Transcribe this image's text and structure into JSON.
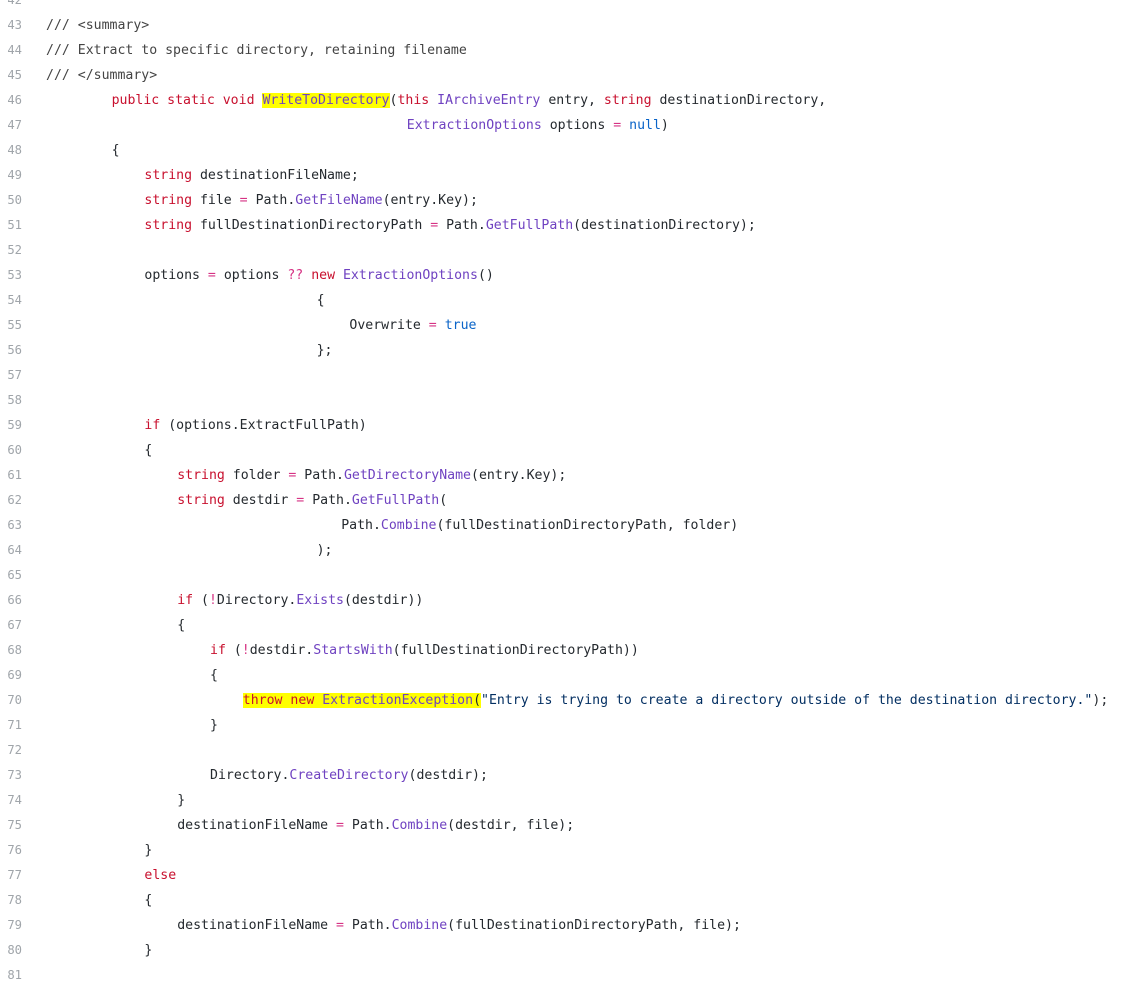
{
  "code_view": {
    "lines": [
      {
        "number": "42",
        "indent": 0,
        "tokens": []
      },
      {
        "number": "43",
        "indent": 0,
        "tokens": [
          {
            "text": "/// <summary>",
            "kind": "com"
          }
        ]
      },
      {
        "number": "44",
        "indent": 0,
        "tokens": [
          {
            "text": "/// Extract to specific directory, retaining filename",
            "kind": "com"
          }
        ]
      },
      {
        "number": "45",
        "indent": 0,
        "tokens": [
          {
            "text": "/// </summary>",
            "kind": "com"
          }
        ]
      },
      {
        "number": "46",
        "indent": 8,
        "tokens": [
          {
            "text": "public static void ",
            "kind": "kw"
          },
          {
            "text": "WriteToDirectory",
            "kind": "type",
            "highlight": true
          },
          {
            "text": "(",
            "kind": "plain"
          },
          {
            "text": "this ",
            "kind": "kw"
          },
          {
            "text": "IArchiveEntry",
            "kind": "type"
          },
          {
            "text": " entry, ",
            "kind": "plain"
          },
          {
            "text": "string",
            "kind": "kw"
          },
          {
            "text": " destinationDirectory,",
            "kind": "plain"
          }
        ]
      },
      {
        "number": "47",
        "indent": 44,
        "tokens": [
          {
            "text": "ExtractionOptions",
            "kind": "type"
          },
          {
            "text": " options ",
            "kind": "plain"
          },
          {
            "text": "=",
            "kind": "op"
          },
          {
            "text": " ",
            "kind": "plain"
          },
          {
            "text": "null",
            "kind": "lit"
          },
          {
            "text": ")",
            "kind": "plain"
          }
        ]
      },
      {
        "number": "48",
        "indent": 8,
        "tokens": [
          {
            "text": "{",
            "kind": "plain"
          }
        ]
      },
      {
        "number": "49",
        "indent": 12,
        "tokens": [
          {
            "text": "string",
            "kind": "kw"
          },
          {
            "text": " destinationFileName;",
            "kind": "plain"
          }
        ]
      },
      {
        "number": "50",
        "indent": 12,
        "tokens": [
          {
            "text": "string",
            "kind": "kw"
          },
          {
            "text": " file ",
            "kind": "plain"
          },
          {
            "text": "=",
            "kind": "op"
          },
          {
            "text": " Path.",
            "kind": "plain"
          },
          {
            "text": "GetFileName",
            "kind": "type"
          },
          {
            "text": "(entry.Key);",
            "kind": "plain"
          }
        ]
      },
      {
        "number": "51",
        "indent": 12,
        "tokens": [
          {
            "text": "string",
            "kind": "kw"
          },
          {
            "text": " fullDestinationDirectoryPath ",
            "kind": "plain"
          },
          {
            "text": "=",
            "kind": "op"
          },
          {
            "text": " Path.",
            "kind": "plain"
          },
          {
            "text": "GetFullPath",
            "kind": "type"
          },
          {
            "text": "(destinationDirectory);",
            "kind": "plain"
          }
        ]
      },
      {
        "number": "52",
        "indent": 0,
        "tokens": []
      },
      {
        "number": "53",
        "indent": 12,
        "tokens": [
          {
            "text": "options ",
            "kind": "plain"
          },
          {
            "text": "=",
            "kind": "op"
          },
          {
            "text": " options ",
            "kind": "plain"
          },
          {
            "text": "??",
            "kind": "op"
          },
          {
            "text": " ",
            "kind": "plain"
          },
          {
            "text": "new",
            "kind": "kw"
          },
          {
            "text": " ",
            "kind": "plain"
          },
          {
            "text": "ExtractionOptions",
            "kind": "type"
          },
          {
            "text": "()",
            "kind": "plain"
          }
        ]
      },
      {
        "number": "54",
        "indent": 33,
        "tokens": [
          {
            "text": "{",
            "kind": "plain"
          }
        ]
      },
      {
        "number": "55",
        "indent": 37,
        "tokens": [
          {
            "text": "Overwrite ",
            "kind": "plain"
          },
          {
            "text": "=",
            "kind": "op"
          },
          {
            "text": " ",
            "kind": "plain"
          },
          {
            "text": "true",
            "kind": "lit"
          }
        ]
      },
      {
        "number": "56",
        "indent": 33,
        "tokens": [
          {
            "text": "};",
            "kind": "plain"
          }
        ]
      },
      {
        "number": "57",
        "indent": 0,
        "tokens": []
      },
      {
        "number": "58",
        "indent": 0,
        "tokens": []
      },
      {
        "number": "59",
        "indent": 12,
        "tokens": [
          {
            "text": "if",
            "kind": "kw"
          },
          {
            "text": " (options.ExtractFullPath)",
            "kind": "plain"
          }
        ]
      },
      {
        "number": "60",
        "indent": 12,
        "tokens": [
          {
            "text": "{",
            "kind": "plain"
          }
        ]
      },
      {
        "number": "61",
        "indent": 16,
        "tokens": [
          {
            "text": "string",
            "kind": "kw"
          },
          {
            "text": " folder ",
            "kind": "plain"
          },
          {
            "text": "=",
            "kind": "op"
          },
          {
            "text": " Path.",
            "kind": "plain"
          },
          {
            "text": "GetDirectoryName",
            "kind": "type"
          },
          {
            "text": "(entry.Key);",
            "kind": "plain"
          }
        ]
      },
      {
        "number": "62",
        "indent": 16,
        "tokens": [
          {
            "text": "string",
            "kind": "kw"
          },
          {
            "text": " destdir ",
            "kind": "plain"
          },
          {
            "text": "=",
            "kind": "op"
          },
          {
            "text": " Path.",
            "kind": "plain"
          },
          {
            "text": "GetFullPath",
            "kind": "type"
          },
          {
            "text": "(",
            "kind": "plain"
          }
        ]
      },
      {
        "number": "63",
        "indent": 36,
        "tokens": [
          {
            "text": "Path.",
            "kind": "plain"
          },
          {
            "text": "Combine",
            "kind": "type"
          },
          {
            "text": "(fullDestinationDirectoryPath, folder)",
            "kind": "plain"
          }
        ]
      },
      {
        "number": "64",
        "indent": 33,
        "tokens": [
          {
            "text": ");",
            "kind": "plain"
          }
        ]
      },
      {
        "number": "65",
        "indent": 0,
        "tokens": []
      },
      {
        "number": "66",
        "indent": 16,
        "tokens": [
          {
            "text": "if",
            "kind": "kw"
          },
          {
            "text": " (",
            "kind": "plain"
          },
          {
            "text": "!",
            "kind": "op"
          },
          {
            "text": "Directory.",
            "kind": "plain"
          },
          {
            "text": "Exists",
            "kind": "type"
          },
          {
            "text": "(destdir))",
            "kind": "plain"
          }
        ]
      },
      {
        "number": "67",
        "indent": 16,
        "tokens": [
          {
            "text": "{",
            "kind": "plain"
          }
        ]
      },
      {
        "number": "68",
        "indent": 20,
        "tokens": [
          {
            "text": "if",
            "kind": "kw"
          },
          {
            "text": " (",
            "kind": "plain"
          },
          {
            "text": "!",
            "kind": "op"
          },
          {
            "text": "destdir.",
            "kind": "plain"
          },
          {
            "text": "StartsWith",
            "kind": "type"
          },
          {
            "text": "(fullDestinationDirectoryPath))",
            "kind": "plain"
          }
        ]
      },
      {
        "number": "69",
        "indent": 20,
        "tokens": [
          {
            "text": "{",
            "kind": "plain"
          }
        ]
      },
      {
        "number": "70",
        "indent": 24,
        "tokens": [
          {
            "text": "throw new ",
            "kind": "kw",
            "highlight": true
          },
          {
            "text": "ExtractionException",
            "kind": "type",
            "highlight": true
          },
          {
            "text": "(",
            "kind": "plain",
            "highlight": true
          },
          {
            "text": "\"Entry is trying to create a directory outside of the destination directory.\"",
            "kind": "str"
          },
          {
            "text": ");",
            "kind": "plain"
          }
        ]
      },
      {
        "number": "71",
        "indent": 20,
        "tokens": [
          {
            "text": "}",
            "kind": "plain"
          }
        ]
      },
      {
        "number": "72",
        "indent": 0,
        "tokens": []
      },
      {
        "number": "73",
        "indent": 20,
        "tokens": [
          {
            "text": "Directory.",
            "kind": "plain"
          },
          {
            "text": "CreateDirectory",
            "kind": "type"
          },
          {
            "text": "(destdir);",
            "kind": "plain"
          }
        ]
      },
      {
        "number": "74",
        "indent": 16,
        "tokens": [
          {
            "text": "}",
            "kind": "plain"
          }
        ]
      },
      {
        "number": "75",
        "indent": 16,
        "tokens": [
          {
            "text": "destinationFileName ",
            "kind": "plain"
          },
          {
            "text": "=",
            "kind": "op"
          },
          {
            "text": " Path.",
            "kind": "plain"
          },
          {
            "text": "Combine",
            "kind": "type"
          },
          {
            "text": "(destdir, file);",
            "kind": "plain"
          }
        ]
      },
      {
        "number": "76",
        "indent": 12,
        "tokens": [
          {
            "text": "}",
            "kind": "plain"
          }
        ]
      },
      {
        "number": "77",
        "indent": 12,
        "tokens": [
          {
            "text": "else",
            "kind": "kw"
          }
        ]
      },
      {
        "number": "78",
        "indent": 12,
        "tokens": [
          {
            "text": "{",
            "kind": "plain"
          }
        ]
      },
      {
        "number": "79",
        "indent": 16,
        "tokens": [
          {
            "text": "destinationFileName ",
            "kind": "plain"
          },
          {
            "text": "=",
            "kind": "op"
          },
          {
            "text": " Path.",
            "kind": "plain"
          },
          {
            "text": "Combine",
            "kind": "type"
          },
          {
            "text": "(fullDestinationDirectoryPath, file);",
            "kind": "plain"
          }
        ]
      },
      {
        "number": "80",
        "indent": 12,
        "tokens": [
          {
            "text": "}",
            "kind": "plain"
          }
        ]
      },
      {
        "number": "81",
        "indent": 0,
        "tokens": []
      }
    ]
  },
  "colors": {
    "keyword": "#c8102e",
    "type_or_method": "#6f42c1",
    "literal": "#0a64c8",
    "comment": "#444444",
    "operator": "#d63384",
    "string": "#032f62",
    "highlight": "#ffff00",
    "line_number": "#a0a5aa"
  }
}
